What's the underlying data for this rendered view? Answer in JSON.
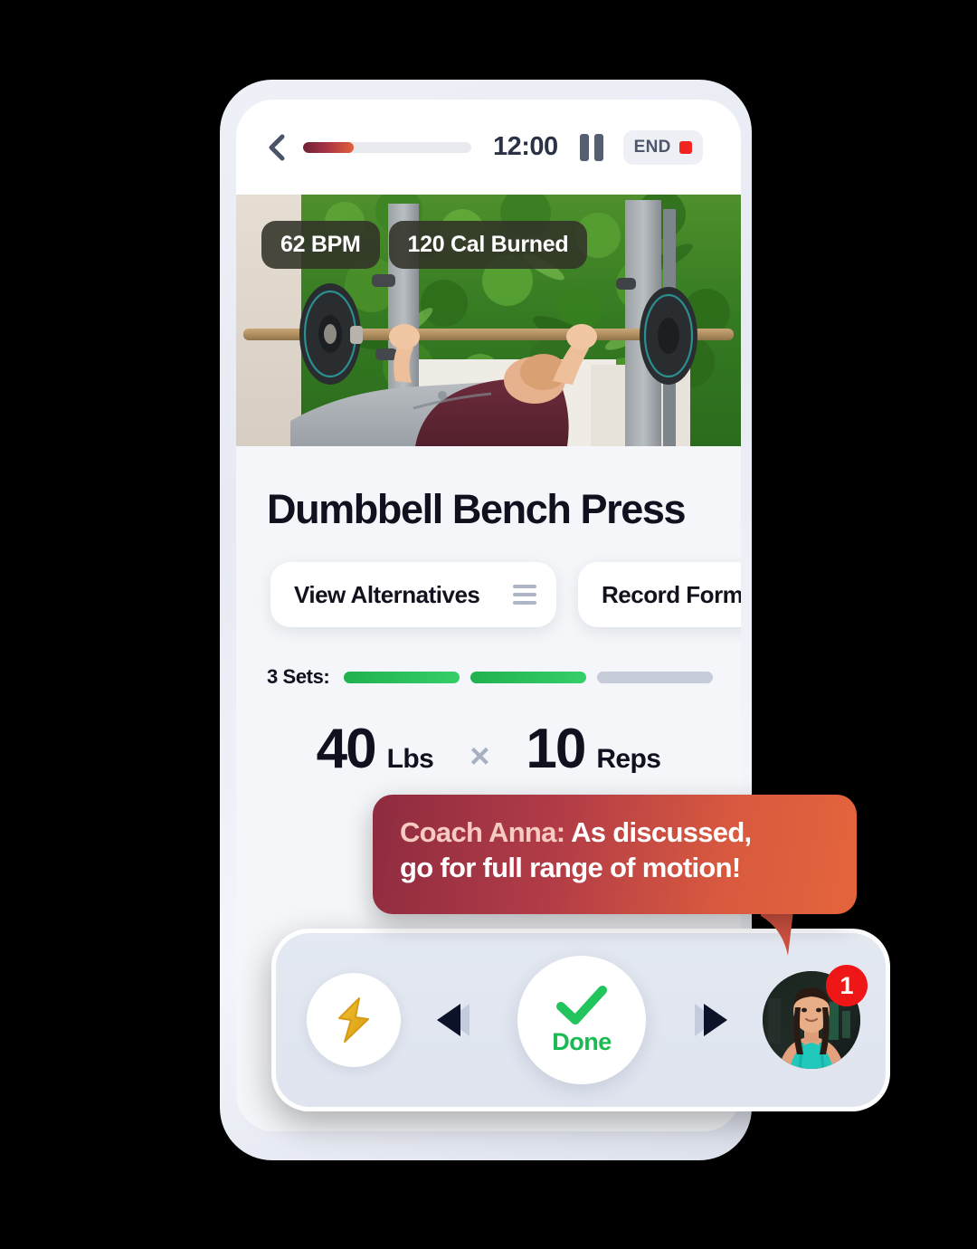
{
  "header": {
    "back_icon": "chevron-left-icon",
    "progress_percent": 30,
    "timer": "12:00",
    "pause_icon": "pause-icon",
    "end_label": "END",
    "end_dot_color": "#f1241f",
    "progress_gradient_from": "#6e2235",
    "progress_gradient_to": "#e2603b"
  },
  "hero": {
    "badges": [
      {
        "label": "62 BPM"
      },
      {
        "label": "120 Cal Burned"
      }
    ],
    "alt": "person performing a bench press in a gym with a green plant wall"
  },
  "exercise": {
    "title": "Dumbbell Bench Press",
    "actions": [
      {
        "label": "View Alternatives",
        "icon": "list-icon"
      },
      {
        "label": "Record Form",
        "icon": "video-camera-icon"
      }
    ],
    "sets_label": "3 Sets:",
    "sets_total": 3,
    "sets_completed": 2,
    "set_done_color": "#2bc25c",
    "set_pending_color": "#c5cbd8",
    "weight_value": "40",
    "weight_unit": "Lbs",
    "multiply_symbol": "×",
    "reps_value": "10",
    "reps_unit": "Reps"
  },
  "coach_message": {
    "sender": "Coach Anna:",
    "line1_rest": " As discussed,",
    "line2": "go for full range of motion!",
    "gradient_from": "#8e2b40",
    "gradient_to": "#e4653c"
  },
  "dock": {
    "boost_icon": "lightning-bolt-icon",
    "prev_icon": "previous-arrow-icon",
    "done_icon": "check-icon",
    "done_label": "Done",
    "done_color": "#18bb51",
    "next_icon": "next-arrow-icon",
    "avatar_icon": "coach-avatar",
    "notification_count": "1",
    "notification_color": "#ee1616"
  }
}
